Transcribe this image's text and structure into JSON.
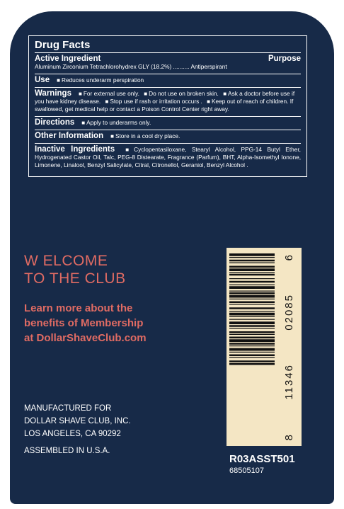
{
  "drug_facts": {
    "title": "Drug Facts",
    "active_ingredient_heading": "Active Ingredient",
    "purpose_heading": "Purpose",
    "active_ingredient": "Aluminum Zirconium Tetrachlorohydrex GLY (18.2%) ..........",
    "purpose": "Antiperspirant",
    "use_heading": "Use",
    "use_text": "Reduces underarm perspiration",
    "warnings_heading": "Warnings",
    "warnings_1": "For external use only.",
    "warnings_2": "Do not use",
    "warnings_2b": "on broken skin.",
    "warnings_3": "Ask a doctor before use",
    "warnings_3b": "if you have kidney disease.",
    "warnings_4": "Stop use",
    "warnings_4b": "if rash or irritation occurs .",
    "warnings_5": "Keep out of reach of children.",
    "warnings_5b": "If swallowed, get medical help or contact a Poison Control Center right away.",
    "directions_heading": "Directions",
    "directions_text": "Apply to underarms only.",
    "other_heading": "Other Information",
    "other_text": "Store in a cool dry place.",
    "inactive_heading": "Inactive Ingredients",
    "inactive_text": "Cyclopentasiloxane, Stearyl Alcohol, PPG-14 Butyl Ether, Hydrogenated Castor Oil, Talc, PEG-8 Distearate, Fragrance (Parfum), BHT, Alpha-Isomethyl Ionone, Limonene, Linalool, Benzyl Salicylate, Citral, Citronellol, Geraniol, Benzyl Alcohol ."
  },
  "promo": {
    "welcome_line1": "W ELCOME",
    "welcome_line2": "TO THE CLUB",
    "learn_line1": "Learn more about the",
    "learn_line2": "benefits of Membership",
    "learn_line3": "at DollarShaveClub.com"
  },
  "manufacturer": {
    "line1": "MANUFACTURED FOR",
    "line2": "DOLLAR SHAVE CLUB, INC.",
    "line3": "LOS ANGELES, CA 90292",
    "assembled": "ASSEMBLED IN U.S.A."
  },
  "barcode": {
    "digit_first": "8",
    "digits_group1": "11346",
    "digits_group2": "02085",
    "digit_last": "6",
    "code_line1": "R03ASST501",
    "code_line2": "68505107"
  },
  "colors": {
    "label_background": "#172a48",
    "accent": "#e06b63",
    "barcode_background": "#f4e6c4"
  }
}
